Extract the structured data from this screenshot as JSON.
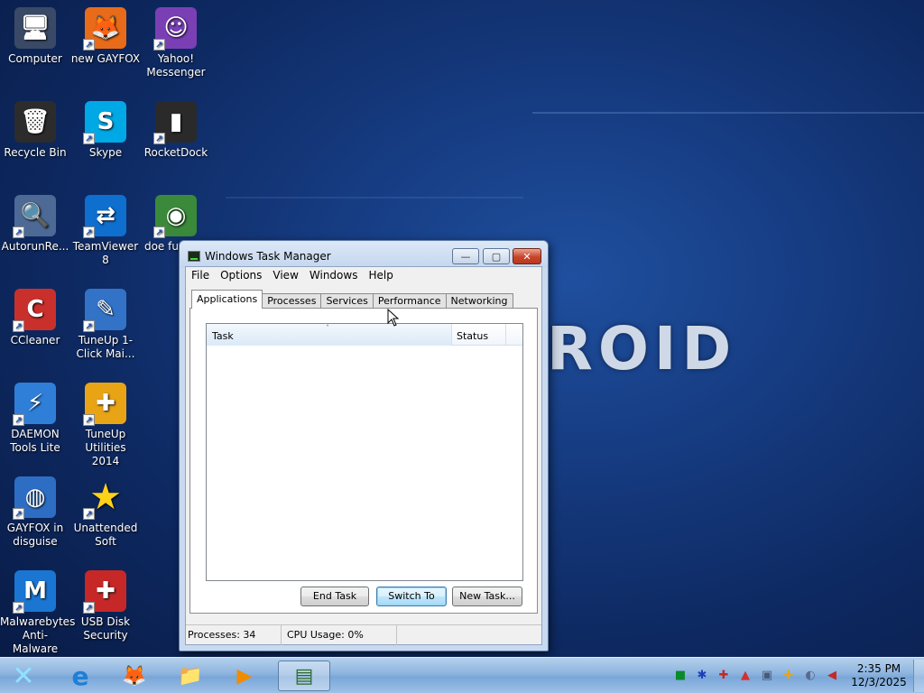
{
  "wallpaper": {
    "text": "ROID"
  },
  "desktop_icons": [
    {
      "label": "Computer",
      "icon": "computer-icon",
      "glyph": "🖥",
      "bg": "#3a4a66"
    },
    {
      "label": "new GAYFOX",
      "icon": "firefox-icon",
      "glyph": "🦊",
      "bg": "#e86b1a"
    },
    {
      "label": "Yahoo! Messenger",
      "icon": "yahoo-messenger-icon",
      "glyph": "☺",
      "bg": "#7a3fb5"
    },
    {
      "label": "Recycle Bin",
      "icon": "recycle-bin-icon",
      "glyph": "🗑",
      "bg": "#2c2c2c"
    },
    {
      "label": "Skype",
      "icon": "skype-icon",
      "glyph": "S",
      "bg": "#00a8e6"
    },
    {
      "label": "RocketDock",
      "icon": "rocketdock-icon",
      "glyph": "▮",
      "bg": "#2a2a2a"
    },
    {
      "label": "AutorunRe...",
      "icon": "autorun-icon",
      "glyph": "🔍",
      "bg": "#4d6a96"
    },
    {
      "label": "TeamViewer 8",
      "icon": "teamviewer-icon",
      "glyph": "⇄",
      "bg": "#0e6fcf"
    },
    {
      "label": "doe fucking",
      "icon": "chrome-icon",
      "glyph": "◉",
      "bg": "#3b8a3b"
    },
    {
      "label": "CCleaner",
      "icon": "ccleaner-icon",
      "glyph": "C",
      "bg": "#c9302c"
    },
    {
      "label": "TuneUp 1-Click Mai...",
      "icon": "tuneup-1click-icon",
      "glyph": "✎",
      "bg": "#3273c8"
    },
    {
      "label": "DAEMON Tools Lite",
      "icon": "daemon-tools-icon",
      "glyph": "⚡",
      "bg": "#2f7fd8"
    },
    {
      "label": "TuneUp Utilities 2014",
      "icon": "tuneup-utilities-icon",
      "glyph": "✚",
      "bg": "#e8a415"
    },
    {
      "label": "GAYFOX in disguise",
      "icon": "globe-icon",
      "glyph": "◍",
      "bg": "#2d6ec4"
    },
    {
      "label": "Unattended Soft",
      "icon": "star-icon",
      "glyph": "★",
      "bg": "transparent"
    },
    {
      "label": "Malwarebytes Anti-Malware",
      "icon": "malwarebytes-icon",
      "glyph": "M",
      "bg": "#1a76d2"
    },
    {
      "label": "USB Disk Security",
      "icon": "shield-icon",
      "glyph": "✚",
      "bg": "#c62828"
    }
  ],
  "window": {
    "title": "Windows Task Manager",
    "buttons": {
      "minimize": "—",
      "maximize": "▢",
      "close": "✕"
    },
    "menu": [
      "File",
      "Options",
      "View",
      "Windows",
      "Help"
    ],
    "tabs": [
      "Applications",
      "Processes",
      "Services",
      "Performance",
      "Networking"
    ],
    "active_tab": "Applications",
    "list": {
      "columns": [
        "Task",
        "Status"
      ],
      "sort_indicator": "˄",
      "rows": []
    },
    "actions": {
      "end_task": "End Task",
      "switch_to": "Switch To",
      "new_task": "New Task..."
    },
    "status": {
      "processes": "Processes: 34",
      "cpu": "CPU Usage: 0%"
    }
  },
  "taskbar": {
    "start_glyph": "✕",
    "pinned": [
      {
        "name": "internet-explorer-icon",
        "glyph": "e"
      },
      {
        "name": "firefox-icon",
        "glyph": "🦊"
      },
      {
        "name": "file-explorer-icon",
        "glyph": "📁"
      },
      {
        "name": "media-player-icon",
        "glyph": "▶"
      },
      {
        "name": "task-manager-icon",
        "glyph": "▤"
      }
    ],
    "tray": [
      {
        "name": "green-square-icon",
        "glyph": "■",
        "color": "#0a8a2a"
      },
      {
        "name": "network-adapter-icon",
        "glyph": "✱",
        "color": "#1c3fbf"
      },
      {
        "name": "security-shield-icon",
        "glyph": "✚",
        "color": "#c62828"
      },
      {
        "name": "warning-icon",
        "glyph": "▲",
        "color": "#d32f2f"
      },
      {
        "name": "monitor-icon",
        "glyph": "▣",
        "color": "#4a5a7a"
      },
      {
        "name": "tuneup-tray-icon",
        "glyph": "✚",
        "color": "#e8a415"
      },
      {
        "name": "network-icon",
        "glyph": "◐",
        "color": "#5a6a8a"
      },
      {
        "name": "volume-muted-icon",
        "glyph": "◀",
        "color": "#c62828"
      }
    ],
    "clock": {
      "time": "2:35 PM",
      "date": "12/3/2025"
    }
  }
}
